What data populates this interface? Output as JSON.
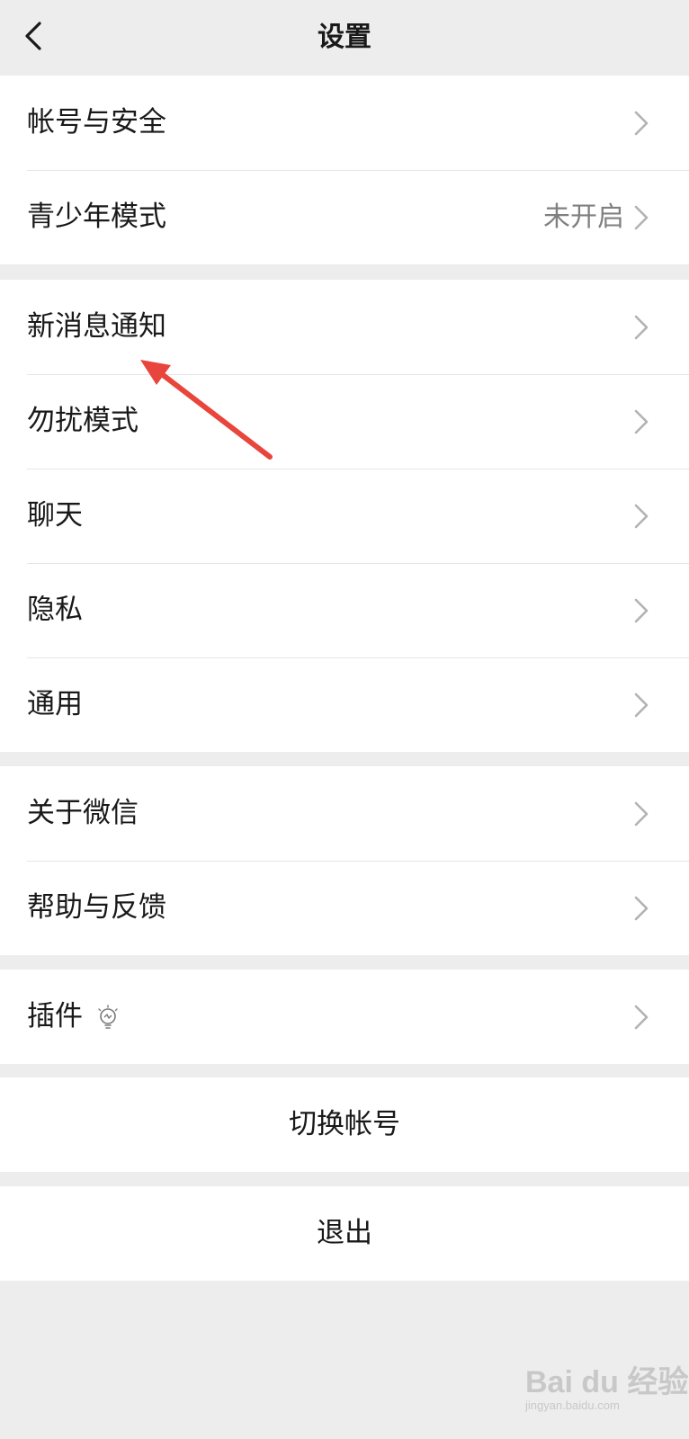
{
  "header": {
    "title": "设置",
    "back_icon": "chevron-left-icon"
  },
  "groups": [
    {
      "items": [
        {
          "label": "帐号与安全",
          "value": ""
        },
        {
          "label": "青少年模式",
          "value": "未开启"
        }
      ]
    },
    {
      "items": [
        {
          "label": "新消息通知",
          "value": ""
        },
        {
          "label": "勿扰模式",
          "value": ""
        },
        {
          "label": "聊天",
          "value": ""
        },
        {
          "label": "隐私",
          "value": ""
        },
        {
          "label": "通用",
          "value": ""
        }
      ]
    },
    {
      "items": [
        {
          "label": "关于微信",
          "value": ""
        },
        {
          "label": "帮助与反馈",
          "value": ""
        }
      ]
    },
    {
      "items": [
        {
          "label": "插件",
          "value": "",
          "icon": "lightbulb-icon"
        }
      ]
    }
  ],
  "actions": {
    "switch_account": "切换帐号",
    "logout": "退出"
  },
  "annotation": {
    "arrow_color": "#e8453c",
    "points_to": "新消息通知"
  },
  "watermark": {
    "text": "Bai du 经验",
    "subtext": "jingyan.baidu.com"
  },
  "colors": {
    "background": "#ededed",
    "cell": "#ffffff",
    "text": "#191919",
    "secondary_text": "#808080",
    "chevron": "#b2b2b2"
  }
}
